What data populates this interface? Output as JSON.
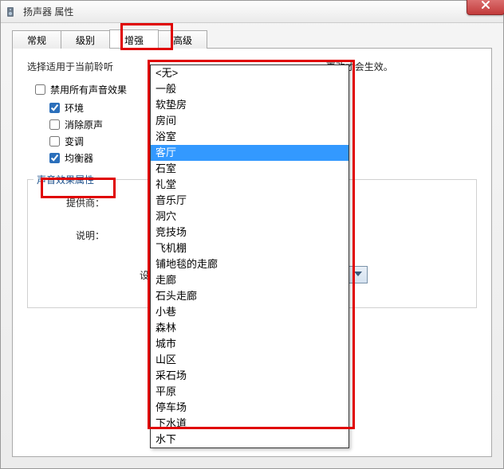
{
  "window": {
    "title": "扬声器 属性"
  },
  "tabs": {
    "items": [
      "常规",
      "级别",
      "增强",
      "高级"
    ],
    "active_index": 2
  },
  "panel": {
    "description_prefix": "选择适用于当前聆听",
    "description_suffix": "更改才会生效。",
    "disable_all": {
      "label": "禁用所有声音效果",
      "checked": false
    },
    "effects": [
      {
        "label": "环境",
        "checked": true
      },
      {
        "label": "消除原声",
        "checked": false
      },
      {
        "label": "变调",
        "checked": false
      },
      {
        "label": "均衡器",
        "checked": true
      }
    ],
    "group_title": "声音效果属性",
    "provider_label": "提供商：",
    "desc_label": "说明：",
    "setting_label": "设置：",
    "setting_value": "客厅"
  },
  "dropdown": {
    "selected_index": 5,
    "options": [
      "<无>",
      "一般",
      "软垫房",
      "房间",
      "浴室",
      "客厅",
      "石室",
      "礼堂",
      "音乐厅",
      "洞穴",
      "竞技场",
      "飞机棚",
      "铺地毯的走廊",
      "走廊",
      "石头走廊",
      "小巷",
      "森林",
      "城市",
      "山区",
      "采石场",
      "平原",
      "停车场",
      "下水道",
      "水下"
    ]
  }
}
